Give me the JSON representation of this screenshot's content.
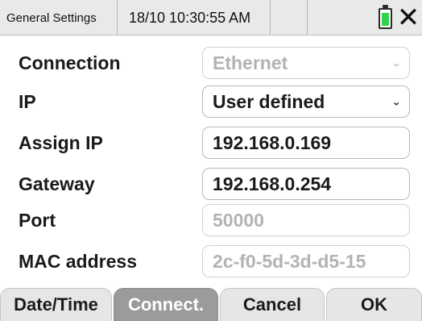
{
  "titlebar": {
    "title": "General Settings",
    "datetime": "18/10 10:30:55 AM",
    "battery_icon": "battery-icon",
    "battery_color": "#33d14a",
    "battery_level": 0.8,
    "close_glyph": "✕"
  },
  "form": {
    "connection": {
      "label": "Connection",
      "value": "Ethernet",
      "disabled": true
    },
    "ip": {
      "label": "IP",
      "value": "User defined",
      "disabled": false
    },
    "assign_ip": {
      "label": "Assign IP",
      "value": "192.168.0.169"
    },
    "gateway": {
      "label": "Gateway",
      "value": "192.168.0.254"
    },
    "port": {
      "label": "Port",
      "value": "50000",
      "disabled": true
    },
    "mac": {
      "label": "MAC address",
      "value": "2c-f0-5d-3d-d5-15",
      "disabled": true
    }
  },
  "softkeys": {
    "datetime": "Date/Time",
    "connect": "Connect.",
    "cancel": "Cancel",
    "ok": "OK",
    "active": "connect"
  },
  "colors": {
    "active_key": "#9b9b9b",
    "key": "#e6e6e6",
    "disabled_text": "#b3b3b3"
  }
}
